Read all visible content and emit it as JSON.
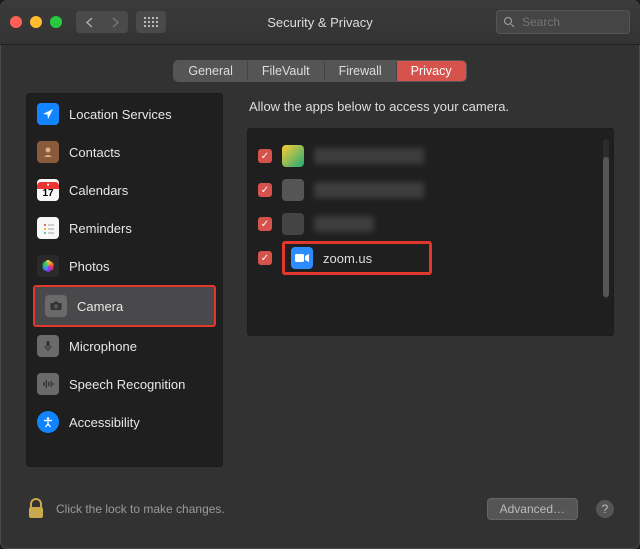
{
  "window": {
    "title": "Security & Privacy"
  },
  "search": {
    "placeholder": "Search"
  },
  "tabs": [
    {
      "label": "General",
      "active": false
    },
    {
      "label": "FileVault",
      "active": false
    },
    {
      "label": "Firewall",
      "active": false
    },
    {
      "label": "Privacy",
      "active": true
    }
  ],
  "sidebar": {
    "items": [
      {
        "label": "Location Services",
        "icon": "location-arrow-icon",
        "color": "#1284ff"
      },
      {
        "label": "Contacts",
        "icon": "contacts-icon",
        "color": "#c07040"
      },
      {
        "label": "Calendars",
        "icon": "calendar-icon",
        "color": "#f7f7f7",
        "badge": "17"
      },
      {
        "label": "Reminders",
        "icon": "reminders-icon",
        "color": "#f7f7f7"
      },
      {
        "label": "Photos",
        "icon": "photos-icon",
        "color": "#3a3a3a"
      },
      {
        "label": "Camera",
        "icon": "camera-icon",
        "color": "#6a6a6a",
        "selected": true,
        "highlighted": true
      },
      {
        "label": "Microphone",
        "icon": "microphone-icon",
        "color": "#6a6a6a"
      },
      {
        "label": "Speech Recognition",
        "icon": "speech-recognition-icon",
        "color": "#6a6a6a"
      },
      {
        "label": "Accessibility",
        "icon": "accessibility-icon",
        "color": "#1284ff"
      }
    ]
  },
  "content": {
    "heading": "Allow the apps below to access your camera.",
    "apps": [
      {
        "name": "",
        "checked": true,
        "redacted": true
      },
      {
        "name": "",
        "checked": true,
        "redacted": true
      },
      {
        "name": "",
        "checked": true,
        "redacted": true
      },
      {
        "name": "zoom.us",
        "checked": true,
        "icon": "zoom-icon",
        "icon_color": "#2d8cff",
        "highlighted": true
      }
    ]
  },
  "footer": {
    "lock_text": "Click the lock to make changes.",
    "advanced_label": "Advanced…",
    "help_label": "?"
  }
}
